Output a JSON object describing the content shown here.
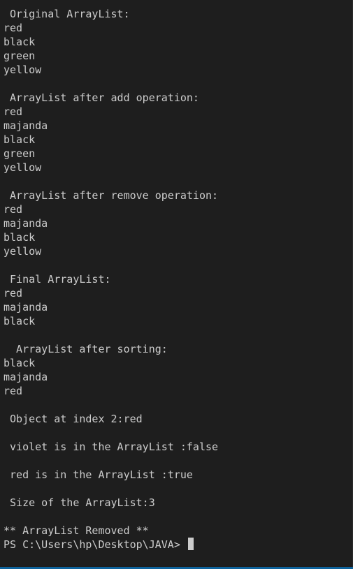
{
  "terminal": {
    "lines": [
      " Original ArrayList:",
      "red",
      "black",
      "green",
      "yellow",
      "",
      " ArrayList after add operation:",
      "red",
      "majanda",
      "black",
      "green",
      "yellow",
      "",
      " ArrayList after remove operation:",
      "red",
      "majanda",
      "black",
      "yellow",
      "",
      " Final ArrayList:",
      "red",
      "majanda",
      "black",
      "",
      "  ArrayList after sorting:",
      "black",
      "majanda",
      "red",
      "",
      " Object at index 2:red",
      "",
      " violet is in the ArrayList :false",
      "",
      " red is in the ArrayList :true",
      "",
      " Size of the ArrayList:3",
      "",
      "** ArrayList Removed **"
    ],
    "prompt": "PS C:\\Users\\hp\\Desktop\\JAVA> "
  },
  "colors": {
    "background": "#1e1e1e",
    "foreground": "#cccccc",
    "status_bar": "#0e639c"
  }
}
